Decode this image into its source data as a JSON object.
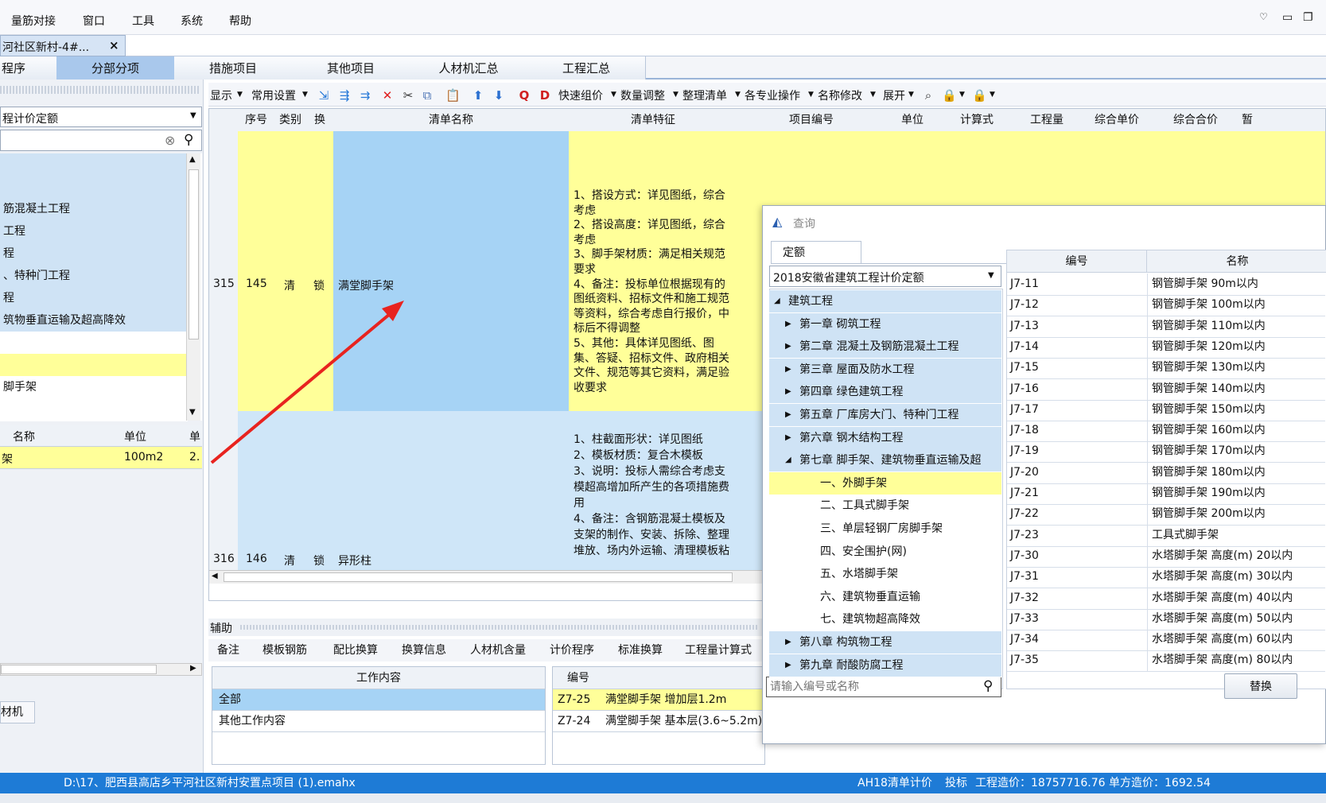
{
  "menu": [
    "量筋对接",
    "窗口",
    "工具",
    "系统",
    "帮助"
  ],
  "doc_tab": {
    "label": "河社区新村-4#...",
    "close": "×"
  },
  "module_tabs": [
    "程序",
    "分部分项",
    "措施项目",
    "其他项目",
    "人材机汇总",
    "工程汇总"
  ],
  "left_panel": {
    "dropdown": "程计价定额",
    "tree_items": [
      "",
      "",
      "筋混凝土工程",
      "工程",
      "程",
      "、特种门工程",
      "程",
      "筑物垂直运输及超高降效",
      "",
      "",
      "脚手架",
      ""
    ],
    "table_headers": [
      "名称",
      "单位",
      "单"
    ],
    "table_row": [
      "架",
      "100m2",
      "2."
    ],
    "bottom_tab": "材机"
  },
  "toolbar": {
    "items": [
      "显示",
      "常用设置",
      "快速组价",
      "数量调整",
      "整理清单",
      "各专业操作",
      "名称修改",
      "展开"
    ]
  },
  "grid": {
    "headers": [
      "序号",
      "类别",
      "换",
      "清单名称",
      "清单特征",
      "项目编号",
      "单位",
      "计算式",
      "工程量",
      "综合单价",
      "综合合价",
      "暂"
    ],
    "rows": [
      {
        "rownum": "315",
        "seq": "145",
        "type": "清",
        "swap": "锁",
        "name": "满堂脚手架",
        "features": "1、搭设方式：详见图纸，综合考虑\n2、搭设高度：详见图纸，综合考虑\n3、脚手架材质：满足相关规范要求\n4、备注：投标单位根据现有的图纸资料、招标文件和施工规范等资料，综合考虑自行报价，中标后不得调整\n5、其他：具体详见图纸、图集、答疑、招标文件、政府相关文件、规范等其它资料，满足验收要求"
      },
      {
        "rownum": "316",
        "seq": "146",
        "type": "清",
        "swap": "锁",
        "name": "异形柱",
        "features": "1、柱截面形状：详见图纸\n2、模板材质：复合木模板\n3、说明：投标人需综合考虑支模超高增加所产生的各项措施费用\n4、备注：含钢筋混凝土模板及支架的制作、安装、拆除、整理堆放、场内外运输、清理模板粘"
      }
    ]
  },
  "aux": {
    "title": "辅助",
    "tabs": [
      "备注",
      "模板钢筋",
      "配比换算",
      "换算信息",
      "人材机含量",
      "计价程序",
      "标准换算",
      "工程量计算式"
    ],
    "work_header": "工作内容",
    "work_rows": [
      "全部",
      "其他工作内容"
    ],
    "quota_header": "编号",
    "quota_rows": [
      [
        "Z7-25",
        "满堂脚手架 增加层1.2m"
      ],
      [
        "Z7-24",
        "满堂脚手架 基本层(3.6~5.2m)"
      ]
    ]
  },
  "dialog": {
    "title": "查询",
    "tab": "定额",
    "dropdown": "2018安徽省建筑工程计价定额",
    "tree": [
      {
        "label": "建筑工程",
        "level": 0,
        "arrow": "◢"
      },
      {
        "label": "第一章 砌筑工程",
        "level": 1,
        "arrow": "▶"
      },
      {
        "label": "第二章 混凝土及钢筋混凝土工程",
        "level": 1,
        "arrow": "▶"
      },
      {
        "label": "第三章 屋面及防水工程",
        "level": 1,
        "arrow": "▶"
      },
      {
        "label": "第四章 绿色建筑工程",
        "level": 1,
        "arrow": "▶"
      },
      {
        "label": "第五章 厂库房大门、特种门工程",
        "level": 1,
        "arrow": "▶"
      },
      {
        "label": "第六章 钢木结构工程",
        "level": 1,
        "arrow": "▶"
      },
      {
        "label": "第七章 脚手架、建筑物垂直运输及超",
        "level": 1,
        "arrow": "◢"
      },
      {
        "label": "一、外脚手架",
        "level": 2,
        "arrow": ""
      },
      {
        "label": "二、工具式脚手架",
        "level": 2,
        "arrow": ""
      },
      {
        "label": "三、单层轻钢厂房脚手架",
        "level": 2,
        "arrow": ""
      },
      {
        "label": "四、安全围护(网)",
        "level": 2,
        "arrow": ""
      },
      {
        "label": "五、水塔脚手架",
        "level": 2,
        "arrow": ""
      },
      {
        "label": "六、建筑物垂直运输",
        "level": 2,
        "arrow": ""
      },
      {
        "label": "七、建筑物超高降效",
        "level": 2,
        "arrow": ""
      },
      {
        "label": "第八章 构筑物工程",
        "level": 1,
        "arrow": "▶"
      },
      {
        "label": "第九章 耐酸防腐工程",
        "level": 1,
        "arrow": "▶"
      }
    ],
    "table_headers": [
      "编号",
      "名称"
    ],
    "table_rows": [
      [
        "J7-11",
        "钢管脚手架 90m以内"
      ],
      [
        "J7-12",
        "钢管脚手架 100m以内"
      ],
      [
        "J7-13",
        "钢管脚手架 110m以内"
      ],
      [
        "J7-14",
        "钢管脚手架 120m以内"
      ],
      [
        "J7-15",
        "钢管脚手架 130m以内"
      ],
      [
        "J7-16",
        "钢管脚手架 140m以内"
      ],
      [
        "J7-17",
        "钢管脚手架 150m以内"
      ],
      [
        "J7-18",
        "钢管脚手架 160m以内"
      ],
      [
        "J7-19",
        "钢管脚手架 170m以内"
      ],
      [
        "J7-20",
        "钢管脚手架 180m以内"
      ],
      [
        "J7-21",
        "钢管脚手架 190m以内"
      ],
      [
        "J7-22",
        "钢管脚手架 200m以内"
      ],
      [
        "J7-23",
        "工具式脚手架"
      ],
      [
        "J7-30",
        "水塔脚手架 高度(m) 20以内"
      ],
      [
        "J7-31",
        "水塔脚手架 高度(m) 30以内"
      ],
      [
        "J7-32",
        "水塔脚手架 高度(m) 40以内"
      ],
      [
        "J7-33",
        "水塔脚手架 高度(m) 50以内"
      ],
      [
        "J7-34",
        "水塔脚手架 高度(m) 60以内"
      ],
      [
        "J7-35",
        "水塔脚手架 高度(m) 80以内"
      ]
    ],
    "search_placeholder": "请输入编号或名称",
    "replace_button": "替换"
  },
  "status": {
    "path": "D:\\17、肥西县高店乡平河社区新村安置点项目 (1).emahx",
    "mode": "AH18清单计价",
    "stage": "投标",
    "cost": "工程造价：18757716.76",
    "unit_cost": "单方造价：1692.54"
  },
  "colors": {
    "accent": "#1e7bd6",
    "selected_yellow": "#ffff99",
    "row_blue": "#cfe6f8",
    "active_tab": "#a9c8ec",
    "arrow_red": "#e8231f"
  }
}
